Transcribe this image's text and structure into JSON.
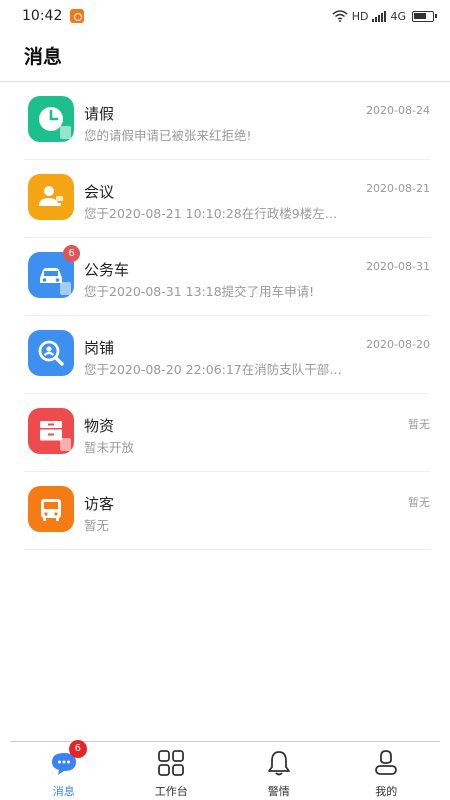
{
  "status_bar": {
    "time": "10:42",
    "network_label": "HD",
    "network_type": "4G"
  },
  "header": {
    "title": "消息"
  },
  "messages": [
    {
      "title": "请假",
      "preview": "您的请假申请已被张来红拒绝!",
      "date": "2020-08-24",
      "icon": "clock-icon",
      "color": "#1dbf8c",
      "badge": ""
    },
    {
      "title": "会议",
      "preview": "您于2020-08-21 10:10:28在行政楼9楼左…",
      "date": "2020-08-21",
      "icon": "meeting-person-icon",
      "color": "#f5a513",
      "badge": ""
    },
    {
      "title": "公务车",
      "preview": "您于2020-08-31 13:18提交了用车申请!",
      "date": "2020-08-31",
      "icon": "car-icon",
      "color": "#3d8ff0",
      "badge": "6"
    },
    {
      "title": "岗铺",
      "preview": "您于2020-08-20 22:06:17在消防支队干部…",
      "date": "2020-08-20",
      "icon": "search-person-icon",
      "color": "#3d8ff0",
      "badge": ""
    },
    {
      "title": "物资",
      "preview": "暂未开放",
      "date": "暂无",
      "icon": "cabinet-icon",
      "color": "#ee4c4c",
      "badge": ""
    },
    {
      "title": "访客",
      "preview": "暂无",
      "date": "暂无",
      "icon": "bus-icon",
      "color": "#f57c14",
      "badge": ""
    }
  ],
  "tabbar": {
    "active_color": "#3b82f6",
    "items": [
      {
        "label": "消息",
        "icon": "chat-bubble-icon",
        "badge": "6",
        "active": true
      },
      {
        "label": "工作台",
        "icon": "grid-icon",
        "badge": "",
        "active": false
      },
      {
        "label": "警情",
        "icon": "bell-icon",
        "badge": "",
        "active": false
      },
      {
        "label": "我的",
        "icon": "user-icon",
        "badge": "",
        "active": false
      }
    ]
  }
}
